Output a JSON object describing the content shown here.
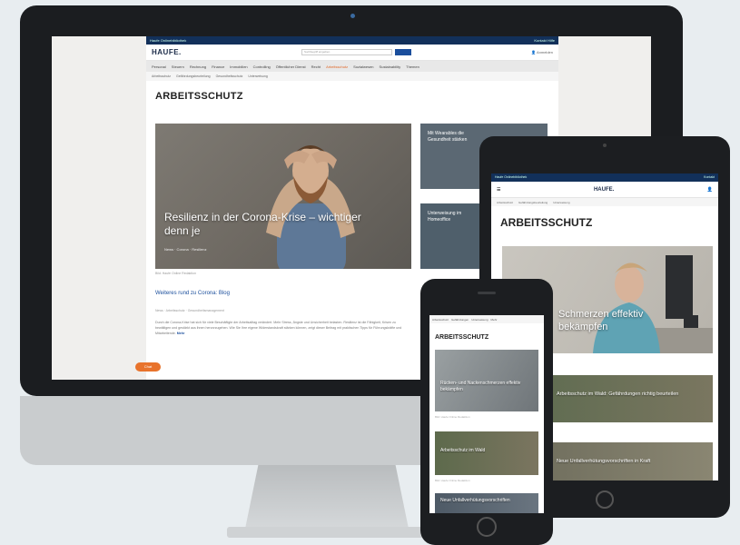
{
  "desktop": {
    "topbar_left": "Haufe Onlinebibliothek",
    "topbar_right": "Kontakt Hilfe",
    "logo": "HAUFE.",
    "search_placeholder": "Suchbegriff eingeben",
    "user_label": "Anmelden",
    "nav_items": [
      "Personal",
      "Steuern",
      "Rechnung",
      "Finance",
      "Immobilien",
      "Controlling",
      "Öffentlicher Dienst",
      "Recht",
      "Arbeitsschutz",
      "Sozialwesen",
      "Sustainability",
      "Themen"
    ],
    "nav_active_index": 8,
    "subnav_items": [
      "Arbeitsschutz",
      "Gefährdungsbeurteilung",
      "Gesundheitsschutz",
      "Unterweisung"
    ],
    "page_title": "ARBEITSSCHUTZ",
    "hero_title": "Resilienz in der Corona-Krise – wichtiger denn je",
    "hero_meta": "News  ·  Corona  ·  Resilienz",
    "hero_caption": "Bild: Haufe Online Redaktion",
    "article_link": "Weiteres rund zu Corona: Blog",
    "article_meta": "News  ·  Arbeitsschutz  ·  Gesundheitsmanagement",
    "article_text": "Durch die Corona-Krise hat sich für viele Beschäftigte der Arbeitsalltag verändert. Mehr Stress, Ängste und Unsicherheit belasten. Resilienz ist die Fähigkeit, Krisen zu bewältigen und gestärkt aus ihnen hervorzugehen. Wie Sie Ihre eigene Widerstandskraft stärken können, zeigt dieser Beitrag mit praktischen Tipps für Führungskräfte und Mitarbeitende.",
    "article_more": "Mehr",
    "side_cards": [
      {
        "title": "Mit Wearables die Gesundheit stärken"
      },
      {
        "title": "Unterweisung im Homeoffice"
      }
    ],
    "cookie_label": "Chat"
  },
  "tablet": {
    "topbar_left": "Haufe Onlinebibliothek",
    "topbar_right": "Kontakt",
    "logo": "HAUFE.",
    "subnav_items": [
      "Arbeitsschutz",
      "Gefährdungsbeurteilung",
      "Unterweisung"
    ],
    "page_title": "ARBEITSSCHUTZ",
    "hero_title": "Schmerzen effektiv bekämpfen",
    "cards": [
      {
        "title": "Arbeitsschutz im Wald: Gefährdungen richtig beurteilen"
      },
      {
        "title": "Neue Unfallverhütungsvorschriften in Kraft"
      }
    ]
  },
  "phone": {
    "nav_items": [
      "Arbeitsschutz",
      "Gefährdungen",
      "Unterweisung",
      "Mehr"
    ],
    "page_title": "ARBEITSSCHUTZ",
    "cards": [
      {
        "title": "Rücken- und Nackenschmerzen effektiv bekämpfen",
        "caption": "Bild: Haufe Online Redaktion"
      },
      {
        "title": "Arbeitsschutz im Wald",
        "caption": "Bild: Haufe Online Redaktion"
      },
      {
        "title": "Neue Unfallverhütungsvorschriften",
        "caption": ""
      }
    ]
  },
  "colors": {
    "brand_blue": "#12305a",
    "accent_orange": "#e8732c",
    "device_dark": "#1b1d20"
  }
}
